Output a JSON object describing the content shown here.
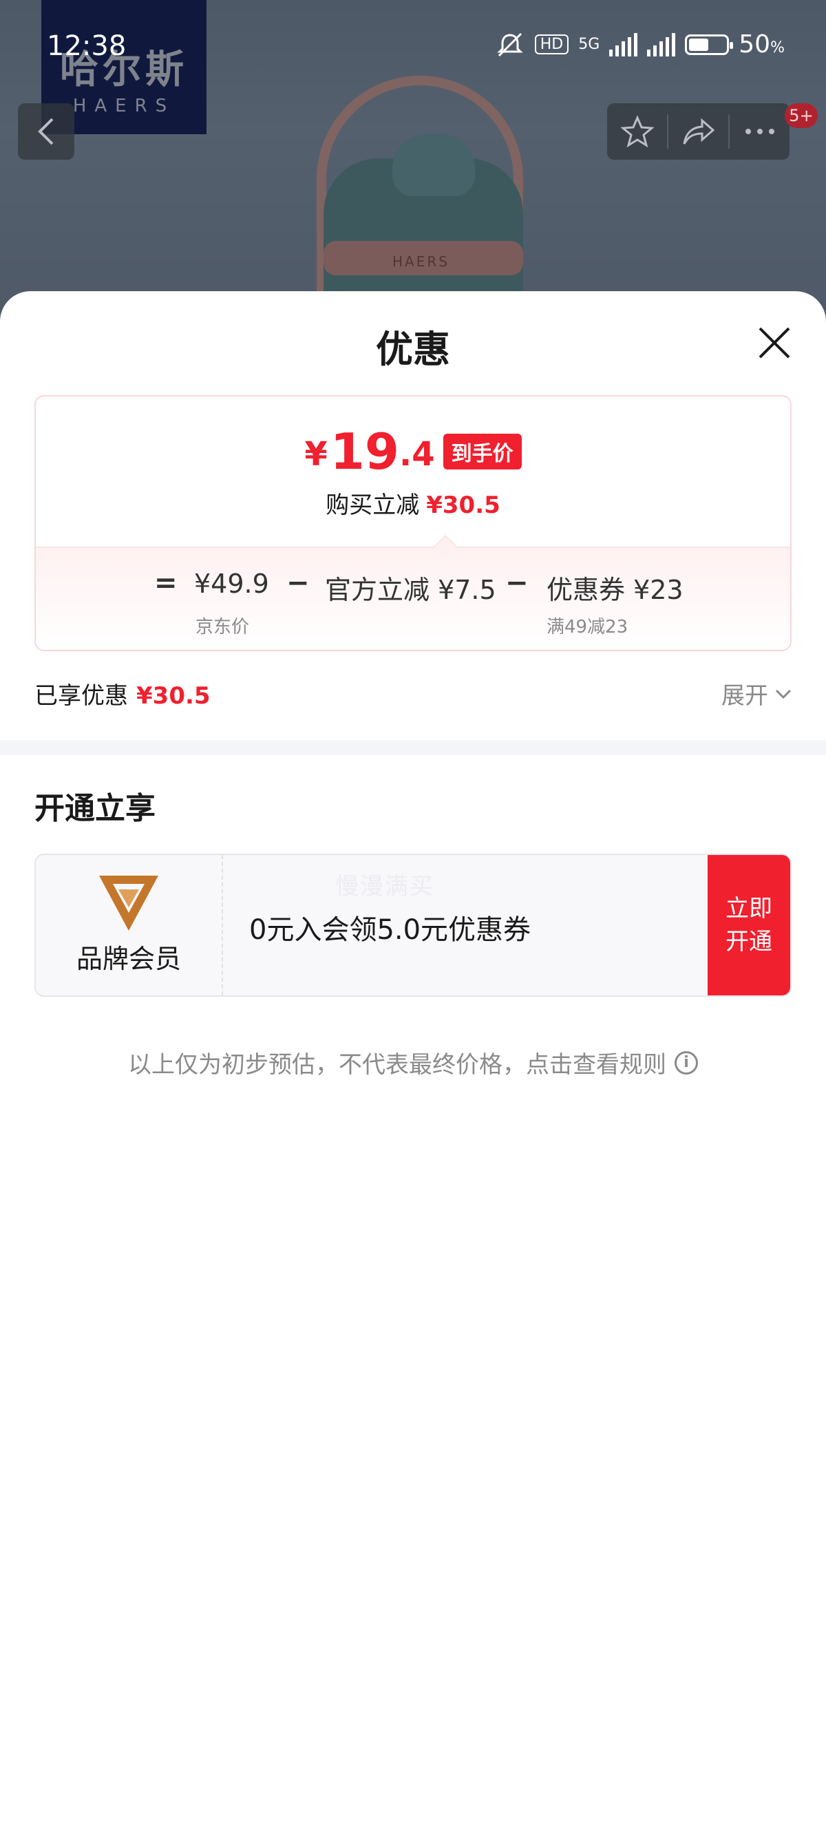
{
  "status_bar": {
    "time": "12:38",
    "net_hd": "HD",
    "net_type": "5G",
    "battery_pct": "50",
    "battery_unit": "%"
  },
  "background": {
    "brand_cn": "哈尔斯",
    "brand_en": "HAERS",
    "product_label": "HAERS",
    "cart_badge": "5+"
  },
  "sheet": {
    "title": "优惠"
  },
  "price_card": {
    "final_currency": "¥",
    "final_integer": "19",
    "final_decimal": ".4",
    "final_tag": "到手价",
    "save_label": "购买立减",
    "save_amount": "¥30.5",
    "formula": {
      "eq": "=",
      "minus": "−",
      "jd_price": "¥49.9",
      "jd_price_label": "京东价",
      "official_discount": "官方立减 ¥7.5",
      "coupon": "优惠券 ¥23",
      "coupon_rule": "满49减23"
    }
  },
  "enjoyed": {
    "label": "已享优惠",
    "amount": "¥30.5",
    "expand_label": "展开"
  },
  "membership": {
    "section_title": "开通立享",
    "brand_member_label": "品牌会员",
    "watermark": "慢漫满买",
    "offer_text": "0元入会领5.0元优惠券",
    "cta_line1": "立即",
    "cta_line2": "开通"
  },
  "disclaimer": {
    "text": "以上仅为初步预估，不代表最终价格，点击查看规则",
    "info_glyph": "i"
  },
  "colors": {
    "accent_red": "#f0202e",
    "brand_navy": "#0d1a57",
    "member_gold": "#c4772a"
  }
}
